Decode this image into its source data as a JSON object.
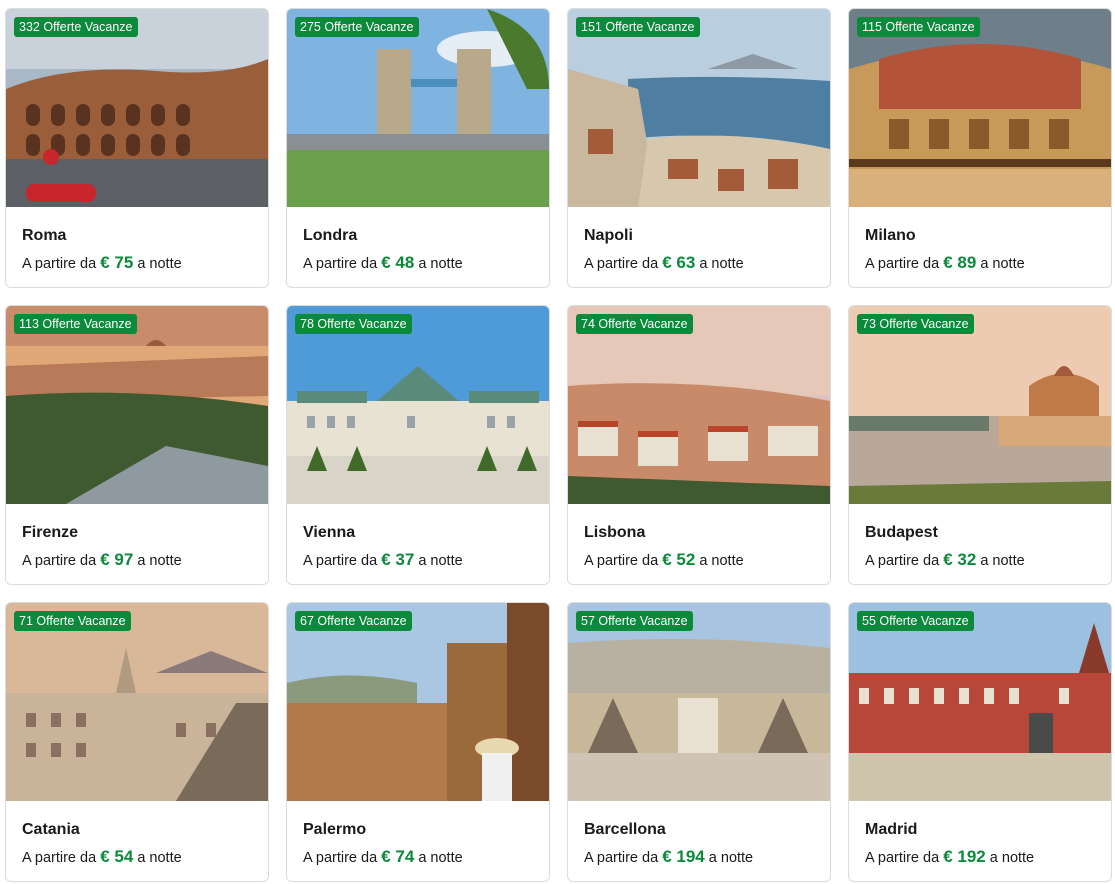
{
  "destinations": [
    {
      "city": "Roma",
      "offers": "332 Offerte Vacanze",
      "price_prefix": "A partire da",
      "price": "€ 75",
      "price_suffix": "a notte",
      "scene": "roma"
    },
    {
      "city": "Londra",
      "offers": "275 Offerte Vacanze",
      "price_prefix": "A partire da",
      "price": "€ 48",
      "price_suffix": "a notte",
      "scene": "londra"
    },
    {
      "city": "Napoli",
      "offers": "151 Offerte Vacanze",
      "price_prefix": "A partire da",
      "price": "€ 63",
      "price_suffix": "a notte",
      "scene": "napoli"
    },
    {
      "city": "Milano",
      "offers": "115 Offerte Vacanze",
      "price_prefix": "A partire da",
      "price": "€ 89",
      "price_suffix": "a notte",
      "scene": "milano"
    },
    {
      "city": "Firenze",
      "offers": "113 Offerte Vacanze",
      "price_prefix": "A partire da",
      "price": "€ 97",
      "price_suffix": "a notte",
      "scene": "firenze"
    },
    {
      "city": "Vienna",
      "offers": "78 Offerte Vacanze",
      "price_prefix": "A partire da",
      "price": "€ 37",
      "price_suffix": "a notte",
      "scene": "vienna"
    },
    {
      "city": "Lisbona",
      "offers": "74 Offerte Vacanze",
      "price_prefix": "A partire da",
      "price": "€ 52",
      "price_suffix": "a notte",
      "scene": "lisbona"
    },
    {
      "city": "Budapest",
      "offers": "73 Offerte Vacanze",
      "price_prefix": "A partire da",
      "price": "€ 32",
      "price_suffix": "a notte",
      "scene": "budapest"
    },
    {
      "city": "Catania",
      "offers": "71 Offerte Vacanze",
      "price_prefix": "A partire da",
      "price": "€ 54",
      "price_suffix": "a notte",
      "scene": "catania"
    },
    {
      "city": "Palermo",
      "offers": "67 Offerte Vacanze",
      "price_prefix": "A partire da",
      "price": "€ 74",
      "price_suffix": "a notte",
      "scene": "palermo"
    },
    {
      "city": "Barcellona",
      "offers": "57 Offerte Vacanze",
      "price_prefix": "A partire da",
      "price": "€ 194",
      "price_suffix": "a notte",
      "scene": "barcellona"
    },
    {
      "city": "Madrid",
      "offers": "55 Offerte Vacanze",
      "price_prefix": "A partire da",
      "price": "€ 192",
      "price_suffix": "a notte",
      "scene": "madrid"
    }
  ],
  "colors": {
    "accent_green": "#0a8a3a",
    "border": "#dcdcdc"
  }
}
